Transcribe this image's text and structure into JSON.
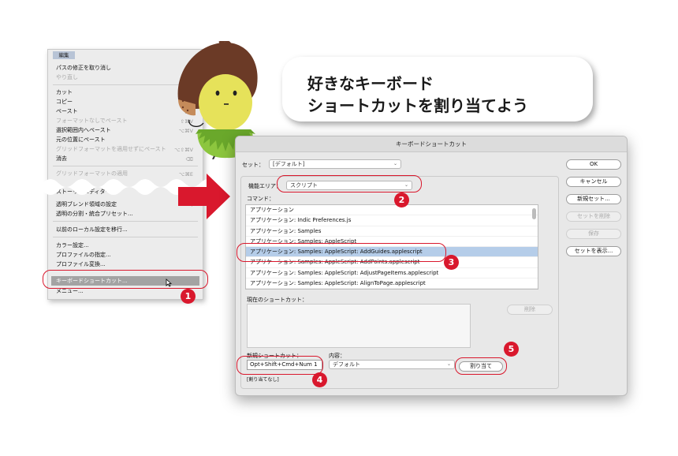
{
  "menu": {
    "title": "編集",
    "items": [
      {
        "label": "パスの修正を取り消し",
        "shortcut": "",
        "disabled": false
      },
      {
        "label": "やり直し",
        "shortcut": "",
        "disabled": true
      },
      {
        "label": "カット",
        "shortcut": "",
        "disabled": false
      },
      {
        "label": "コピー",
        "shortcut": "",
        "disabled": false
      },
      {
        "label": "ペースト",
        "shortcut": "⌘V",
        "disabled": false
      },
      {
        "label": "フォーマットなしでペースト",
        "shortcut": "⇧⌘V",
        "disabled": true
      },
      {
        "label": "選択範囲内へペースト",
        "shortcut": "⌥⌘V",
        "disabled": false
      },
      {
        "label": "元の位置にペースト",
        "shortcut": "",
        "disabled": false
      },
      {
        "label": "グリッドフォーマットを適用せずにペースト",
        "shortcut": "⌥⇧⌘V",
        "disabled": true
      },
      {
        "label": "消去",
        "shortcut": "⌫",
        "disabled": false
      },
      {
        "label": "グリッドフォーマットの適用",
        "shortcut": "⌥⌘E",
        "disabled": true
      },
      {
        "label": "ストーリーエディター",
        "shortcut": "",
        "disabled": false
      },
      {
        "label": "透明ブレンド領域の設定",
        "shortcut": "",
        "disabled": false
      },
      {
        "label": "透明の分割・統合プリセット...",
        "shortcut": "",
        "disabled": false
      },
      {
        "label": "以前のローカル設定を移行...",
        "shortcut": "",
        "disabled": false
      },
      {
        "label": "カラー設定...",
        "shortcut": "",
        "disabled": false
      },
      {
        "label": "プロファイルの指定...",
        "shortcut": "",
        "disabled": false
      },
      {
        "label": "プロファイル変換...",
        "shortcut": "",
        "disabled": false
      },
      {
        "label": "キーボードショートカット...",
        "shortcut": "",
        "disabled": false
      },
      {
        "label": "メニュー...",
        "shortcut": "",
        "disabled": false
      }
    ]
  },
  "bubble": {
    "line1": "好きなキーボード",
    "line2": "ショートカットを割り当てよう"
  },
  "dialog": {
    "title": "キーボードショートカット",
    "set_label": "セット：",
    "set_value": "[デフォルト]",
    "area_label": "機能エリア：",
    "area_value": "スクリプト",
    "command_label": "コマンド：",
    "commands": [
      "アプリケーション",
      "アプリケーション: Indic Preferences.js",
      "アプリケーション: Samples",
      "アプリケーション: Samples: AppleScript",
      "アプリケーション: Samples: AppleScript: AddGuides.applescript",
      "アプリケーション: Samples: AppleScript: AddPoints.applescript",
      "アプリケーション: Samples: AppleScript: AdjustPageItems.applescript",
      "アプリケーション: Samples: AppleScript: AlignToPage.applescript"
    ],
    "selected_index": 4,
    "current_label": "現在のショートカット：",
    "delete_button": "削除",
    "new_shortcut_label": "新規ショートカット：",
    "new_shortcut_value": "Opt+Shift+Cmd+Num 1",
    "context_label": "内容：",
    "context_value": "デフォルト",
    "assign_button": "割り当て",
    "status_text": "[割り当てなし]",
    "buttons": {
      "ok": "OK",
      "cancel": "キャンセル",
      "new_set": "新規セット...",
      "delete_set": "セットを削除",
      "save": "保存",
      "show_set": "セットを表示..."
    }
  },
  "callouts": [
    "1",
    "2",
    "3",
    "4",
    "5"
  ],
  "colors": {
    "accent_red": "#d9182d",
    "selection_blue": "#b5cde9",
    "menu_highlight": "#a3a3a3"
  }
}
